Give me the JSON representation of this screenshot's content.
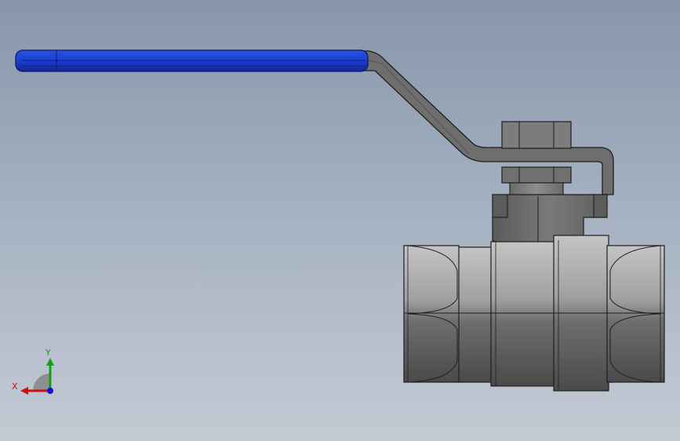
{
  "viewport": {
    "background_top": "#8796ab",
    "background_bottom": "#c3cad4"
  },
  "model": {
    "handle_grip_color": "#1a3ed0",
    "handle_color": "#6a6a6a",
    "body_color": "#8a8a8a",
    "outline_color": "#1e1e1e"
  },
  "triad": {
    "x_label": "X",
    "y_label": "Y",
    "x_color": "#d01010",
    "y_color": "#10a010",
    "z_color": "#1010d0"
  }
}
